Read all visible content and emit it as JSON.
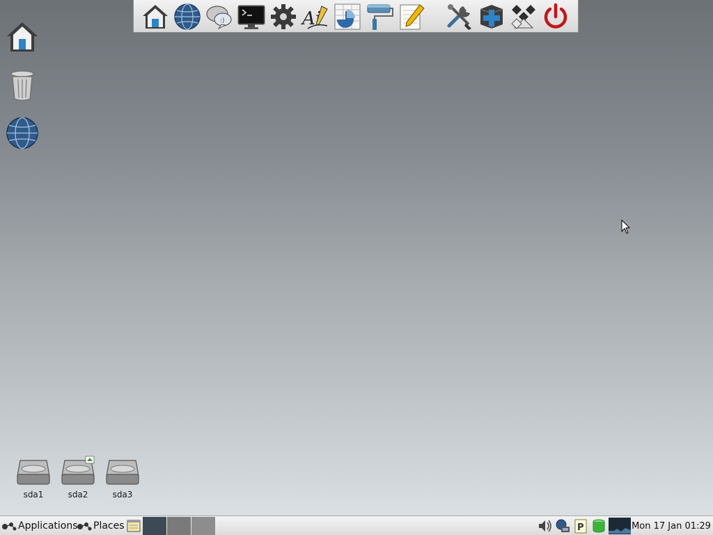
{
  "launcher": {
    "items": [
      {
        "name": "home-folder-icon"
      },
      {
        "name": "web-browser-icon"
      },
      {
        "name": "chat-icon"
      },
      {
        "name": "terminal-icon"
      },
      {
        "name": "settings-gear-icon"
      },
      {
        "name": "text-editor-ai-icon"
      },
      {
        "name": "spreadsheet-icon"
      },
      {
        "name": "paint-roller-icon"
      },
      {
        "name": "notepad-pencil-icon"
      },
      {
        "name": "tools-icon"
      },
      {
        "name": "package-install-icon"
      },
      {
        "name": "diamond-app-icon"
      },
      {
        "name": "power-icon"
      }
    ]
  },
  "desktop": {
    "top_icons": [
      {
        "name": "home-icon"
      },
      {
        "name": "trash-icon"
      },
      {
        "name": "globe-icon"
      }
    ],
    "drives": [
      {
        "label": "sda1"
      },
      {
        "label": "sda2"
      },
      {
        "label": "sda3"
      }
    ]
  },
  "panel": {
    "applications_label": "Applications",
    "places_label": "Places",
    "clock": "Mon 17 Jan 01:29"
  },
  "colors": {
    "power_red": "#c2161a",
    "globe_blue": "#2f5a8a",
    "volume_green": "#3cb43c"
  }
}
